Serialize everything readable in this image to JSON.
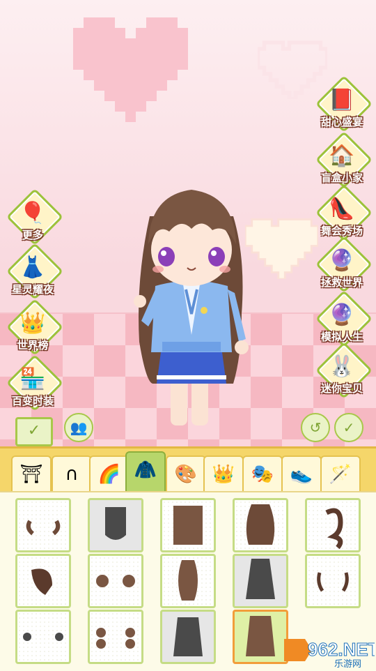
{
  "side_menu_right": [
    {
      "label": "甜心盛宴",
      "icon": "gift-book-icon",
      "emoji": "📕"
    },
    {
      "label": "盲盒小家",
      "icon": "blind-box-house-icon",
      "emoji": "🏠"
    },
    {
      "label": "舞会秀场",
      "icon": "high-heel-icon",
      "emoji": "👠"
    },
    {
      "label": "拯救世界",
      "icon": "magic-circle-icon",
      "emoji": "🔮"
    },
    {
      "label": "模拟人生",
      "icon": "crystal-ball-icon",
      "emoji": "🔮"
    },
    {
      "label": "迷你宝贝",
      "icon": "bunny-cake-icon",
      "emoji": "🐰"
    }
  ],
  "side_menu_left": [
    {
      "label": "更多",
      "icon": "balloons-icon",
      "emoji": "🎈"
    },
    {
      "label": "星灵耀夜",
      "icon": "star-dress-icon",
      "emoji": "👗"
    },
    {
      "label": "世界榜",
      "icon": "crown-icon",
      "emoji": "👑"
    },
    {
      "label": "百变时装",
      "icon": "shop-icon",
      "emoji": "🏪"
    }
  ],
  "tabs": [
    {
      "name": "eyebrow-tab",
      "icon": "face-icon"
    },
    {
      "name": "bangs-tab",
      "icon": "bangs-icon"
    },
    {
      "name": "rainbow-hair-tab",
      "icon": "rainbow-hair-icon"
    },
    {
      "name": "back-hair-tab",
      "icon": "back-hair-icon"
    },
    {
      "name": "hair-color-tab",
      "icon": "color-hair-icon"
    },
    {
      "name": "crown-tab",
      "icon": "crown-icon"
    },
    {
      "name": "mask-tab",
      "icon": "mask-icon"
    },
    {
      "name": "shoes-tab",
      "icon": "shoe-icon"
    },
    {
      "name": "wand-tab",
      "icon": "wand-icon"
    }
  ],
  "active_tab": 3,
  "selected_item": 13,
  "colors": {
    "accent_green": "#a8c84a",
    "tab_bar": "#f5d66a",
    "hair": "#7a5642",
    "jacket": "#8bb8ef"
  },
  "watermark": {
    "text": "962.NET",
    "sub": "乐游网"
  }
}
